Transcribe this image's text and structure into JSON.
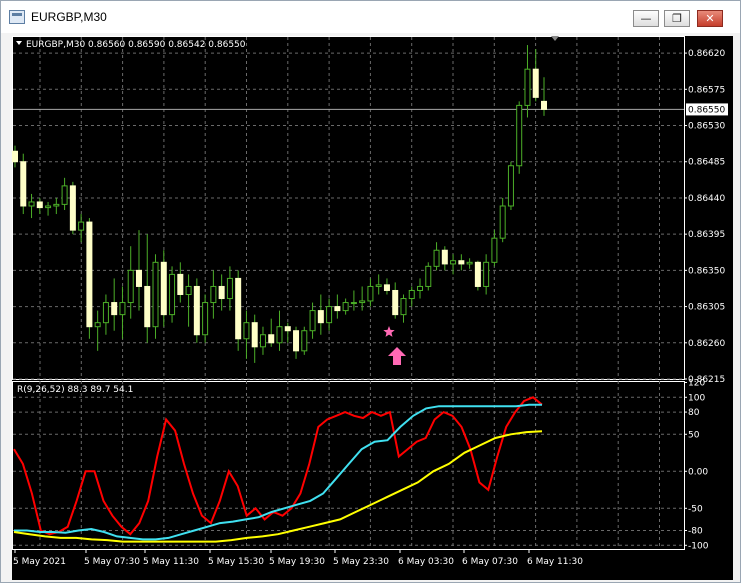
{
  "window": {
    "title": "EURGBP,M30",
    "minimize_glyph": "—",
    "restore_glyph": "❐",
    "close_glyph": "✕",
    "icon": "chart-window-icon"
  },
  "main_chart": {
    "header": "EURGBP,M30  0.86560 0.86590 0.86542 0.86550",
    "price_labels": [
      "0.86620",
      "0.86575",
      "0.86530",
      "0.86485",
      "0.86440",
      "0.86395",
      "0.86350",
      "0.86305",
      "0.86260",
      "0.86215"
    ],
    "current_price": "0.86550",
    "markers": [
      "star-marker",
      "arrow-up-icon"
    ]
  },
  "indicator": {
    "header": "R(9,26,52) 88.3 89.7 54.1",
    "scale_labels": [
      "120",
      "100",
      "80",
      "50",
      "0.00",
      "-50",
      "-80",
      "-100"
    ]
  },
  "time_labels": [
    "5 May 2021",
    "5 May 07:30",
    "5 May 11:30",
    "5 May 15:30",
    "5 May 19:30",
    "5 May 23:30",
    "6 May 03:30",
    "6 May 07:30",
    "6 May 11:30"
  ],
  "colors": {
    "candle": "#ffffc8",
    "wick": "#4caf28",
    "red_line": "#ff0000",
    "cyan_line": "#40e0f0",
    "yellow_line": "#ffff00",
    "marker": "#ff69b4"
  },
  "chart_data": [
    {
      "type": "candlestick",
      "title": "EURGBP,M30",
      "ylim": [
        0.86215,
        0.8664
      ],
      "candles": [
        {
          "o": 0.86498,
          "h": 0.86505,
          "l": 0.86478,
          "c": 0.86485
        },
        {
          "o": 0.86485,
          "h": 0.86495,
          "l": 0.8642,
          "c": 0.8643
        },
        {
          "o": 0.8643,
          "h": 0.86445,
          "l": 0.86415,
          "c": 0.86435
        },
        {
          "o": 0.86435,
          "h": 0.8644,
          "l": 0.8642,
          "c": 0.86428
        },
        {
          "o": 0.86428,
          "h": 0.86435,
          "l": 0.86418,
          "c": 0.8643
        },
        {
          "o": 0.8643,
          "h": 0.8644,
          "l": 0.8642,
          "c": 0.86432
        },
        {
          "o": 0.86432,
          "h": 0.86465,
          "l": 0.86425,
          "c": 0.86455
        },
        {
          "o": 0.86455,
          "h": 0.8646,
          "l": 0.86395,
          "c": 0.864
        },
        {
          "o": 0.864,
          "h": 0.8642,
          "l": 0.86385,
          "c": 0.8641
        },
        {
          "o": 0.8641,
          "h": 0.86415,
          "l": 0.86265,
          "c": 0.8628
        },
        {
          "o": 0.8628,
          "h": 0.863,
          "l": 0.8625,
          "c": 0.86285
        },
        {
          "o": 0.86285,
          "h": 0.8632,
          "l": 0.8627,
          "c": 0.8631
        },
        {
          "o": 0.8631,
          "h": 0.8634,
          "l": 0.86275,
          "c": 0.86295
        },
        {
          "o": 0.86295,
          "h": 0.8633,
          "l": 0.86265,
          "c": 0.8631
        },
        {
          "o": 0.8631,
          "h": 0.8638,
          "l": 0.8629,
          "c": 0.8635
        },
        {
          "o": 0.8635,
          "h": 0.864,
          "l": 0.863,
          "c": 0.8633
        },
        {
          "o": 0.8633,
          "h": 0.86395,
          "l": 0.8626,
          "c": 0.8628
        },
        {
          "o": 0.8628,
          "h": 0.8637,
          "l": 0.86265,
          "c": 0.8636
        },
        {
          "o": 0.8636,
          "h": 0.86375,
          "l": 0.8628,
          "c": 0.86295
        },
        {
          "o": 0.86295,
          "h": 0.86355,
          "l": 0.86285,
          "c": 0.86345
        },
        {
          "o": 0.86345,
          "h": 0.8636,
          "l": 0.8631,
          "c": 0.8632
        },
        {
          "o": 0.8632,
          "h": 0.86345,
          "l": 0.8628,
          "c": 0.8633
        },
        {
          "o": 0.8633,
          "h": 0.8634,
          "l": 0.8626,
          "c": 0.8627
        },
        {
          "o": 0.8627,
          "h": 0.8632,
          "l": 0.8626,
          "c": 0.8631
        },
        {
          "o": 0.8631,
          "h": 0.8635,
          "l": 0.8629,
          "c": 0.8633
        },
        {
          "o": 0.8633,
          "h": 0.86345,
          "l": 0.863,
          "c": 0.86315
        },
        {
          "o": 0.86315,
          "h": 0.86355,
          "l": 0.863,
          "c": 0.8634
        },
        {
          "o": 0.8634,
          "h": 0.8635,
          "l": 0.8625,
          "c": 0.86265
        },
        {
          "o": 0.86265,
          "h": 0.863,
          "l": 0.8624,
          "c": 0.86285
        },
        {
          "o": 0.86285,
          "h": 0.86295,
          "l": 0.86235,
          "c": 0.86255
        },
        {
          "o": 0.86255,
          "h": 0.8628,
          "l": 0.86245,
          "c": 0.8627
        },
        {
          "o": 0.8627,
          "h": 0.8629,
          "l": 0.86255,
          "c": 0.8626
        },
        {
          "o": 0.8626,
          "h": 0.863,
          "l": 0.8625,
          "c": 0.8628
        },
        {
          "o": 0.8628,
          "h": 0.86285,
          "l": 0.8626,
          "c": 0.86275
        },
        {
          "o": 0.86275,
          "h": 0.8628,
          "l": 0.8624,
          "c": 0.8625
        },
        {
          "o": 0.8625,
          "h": 0.8628,
          "l": 0.86245,
          "c": 0.86275
        },
        {
          "o": 0.86275,
          "h": 0.8631,
          "l": 0.86265,
          "c": 0.863
        },
        {
          "o": 0.863,
          "h": 0.8632,
          "l": 0.8627,
          "c": 0.86285
        },
        {
          "o": 0.86285,
          "h": 0.86315,
          "l": 0.86275,
          "c": 0.86305
        },
        {
          "o": 0.86305,
          "h": 0.8632,
          "l": 0.8629,
          "c": 0.863
        },
        {
          "o": 0.863,
          "h": 0.86315,
          "l": 0.86295,
          "c": 0.8631
        },
        {
          "o": 0.8631,
          "h": 0.86325,
          "l": 0.863,
          "c": 0.8631
        },
        {
          "o": 0.8631,
          "h": 0.8633,
          "l": 0.863,
          "c": 0.86312
        },
        {
          "o": 0.86312,
          "h": 0.8634,
          "l": 0.86305,
          "c": 0.8633
        },
        {
          "o": 0.8633,
          "h": 0.86345,
          "l": 0.8632,
          "c": 0.86332
        },
        {
          "o": 0.86332,
          "h": 0.8634,
          "l": 0.8632,
          "c": 0.86325
        },
        {
          "o": 0.86325,
          "h": 0.86335,
          "l": 0.8629,
          "c": 0.86295
        },
        {
          "o": 0.86295,
          "h": 0.8632,
          "l": 0.86285,
          "c": 0.86315
        },
        {
          "o": 0.86315,
          "h": 0.8633,
          "l": 0.86305,
          "c": 0.86325
        },
        {
          "o": 0.86325,
          "h": 0.8634,
          "l": 0.86315,
          "c": 0.8633
        },
        {
          "o": 0.8633,
          "h": 0.8636,
          "l": 0.86325,
          "c": 0.86355
        },
        {
          "o": 0.86355,
          "h": 0.86385,
          "l": 0.8635,
          "c": 0.86375
        },
        {
          "o": 0.86375,
          "h": 0.8638,
          "l": 0.8635,
          "c": 0.86358
        },
        {
          "o": 0.86358,
          "h": 0.8637,
          "l": 0.86345,
          "c": 0.86362
        },
        {
          "o": 0.86362,
          "h": 0.8637,
          "l": 0.8635,
          "c": 0.86358
        },
        {
          "o": 0.86358,
          "h": 0.86365,
          "l": 0.86352,
          "c": 0.8636
        },
        {
          "o": 0.8636,
          "h": 0.86362,
          "l": 0.86325,
          "c": 0.8633
        },
        {
          "o": 0.8633,
          "h": 0.8637,
          "l": 0.8632,
          "c": 0.8636
        },
        {
          "o": 0.8636,
          "h": 0.864,
          "l": 0.86355,
          "c": 0.8639
        },
        {
          "o": 0.8639,
          "h": 0.8644,
          "l": 0.86385,
          "c": 0.8643
        },
        {
          "o": 0.8643,
          "h": 0.86485,
          "l": 0.86425,
          "c": 0.8648
        },
        {
          "o": 0.8648,
          "h": 0.8656,
          "l": 0.8647,
          "c": 0.86555
        },
        {
          "o": 0.86555,
          "h": 0.8663,
          "l": 0.8654,
          "c": 0.866
        },
        {
          "o": 0.866,
          "h": 0.86625,
          "l": 0.8656,
          "c": 0.86565
        },
        {
          "o": 0.8656,
          "h": 0.8659,
          "l": 0.86542,
          "c": 0.8655
        }
      ]
    },
    {
      "type": "line",
      "title": "R(9,26,52)",
      "ylim": [
        -105,
        122
      ],
      "series": [
        {
          "color": "red",
          "values": [
            30,
            10,
            -30,
            -80,
            -85,
            -82,
            -75,
            -40,
            0,
            0,
            -40,
            -60,
            -75,
            -85,
            -70,
            -40,
            20,
            70,
            55,
            10,
            -30,
            -60,
            -70,
            -40,
            0,
            -20,
            -60,
            -50,
            -65,
            -55,
            -60,
            -50,
            -30,
            10,
            60,
            70,
            75,
            80,
            75,
            72,
            80,
            75,
            80,
            20,
            30,
            40,
            45,
            70,
            80,
            75,
            60,
            30,
            -15,
            -25,
            20,
            60,
            80,
            95,
            100,
            90
          ]
        },
        {
          "color": "cyan",
          "values": [
            -80,
            -80,
            -82,
            -82,
            -83,
            -80,
            -78,
            -82,
            -88,
            -90,
            -92,
            -92,
            -90,
            -85,
            -80,
            -75,
            -70,
            -68,
            -65,
            -62,
            -55,
            -50,
            -45,
            -40,
            -30,
            -10,
            10,
            30,
            40,
            42,
            60,
            75,
            85,
            88,
            88,
            88,
            88,
            88,
            88,
            88,
            90,
            90
          ]
        },
        {
          "color": "yellow",
          "values": [
            -82,
            -85,
            -88,
            -90,
            -90,
            -92,
            -93,
            -95,
            -95,
            -95,
            -95,
            -95,
            -95,
            -95,
            -93,
            -90,
            -88,
            -85,
            -80,
            -75,
            -70,
            -65,
            -55,
            -45,
            -35,
            -25,
            -15,
            0,
            10,
            25,
            35,
            45,
            50,
            53,
            54
          ]
        }
      ]
    }
  ]
}
